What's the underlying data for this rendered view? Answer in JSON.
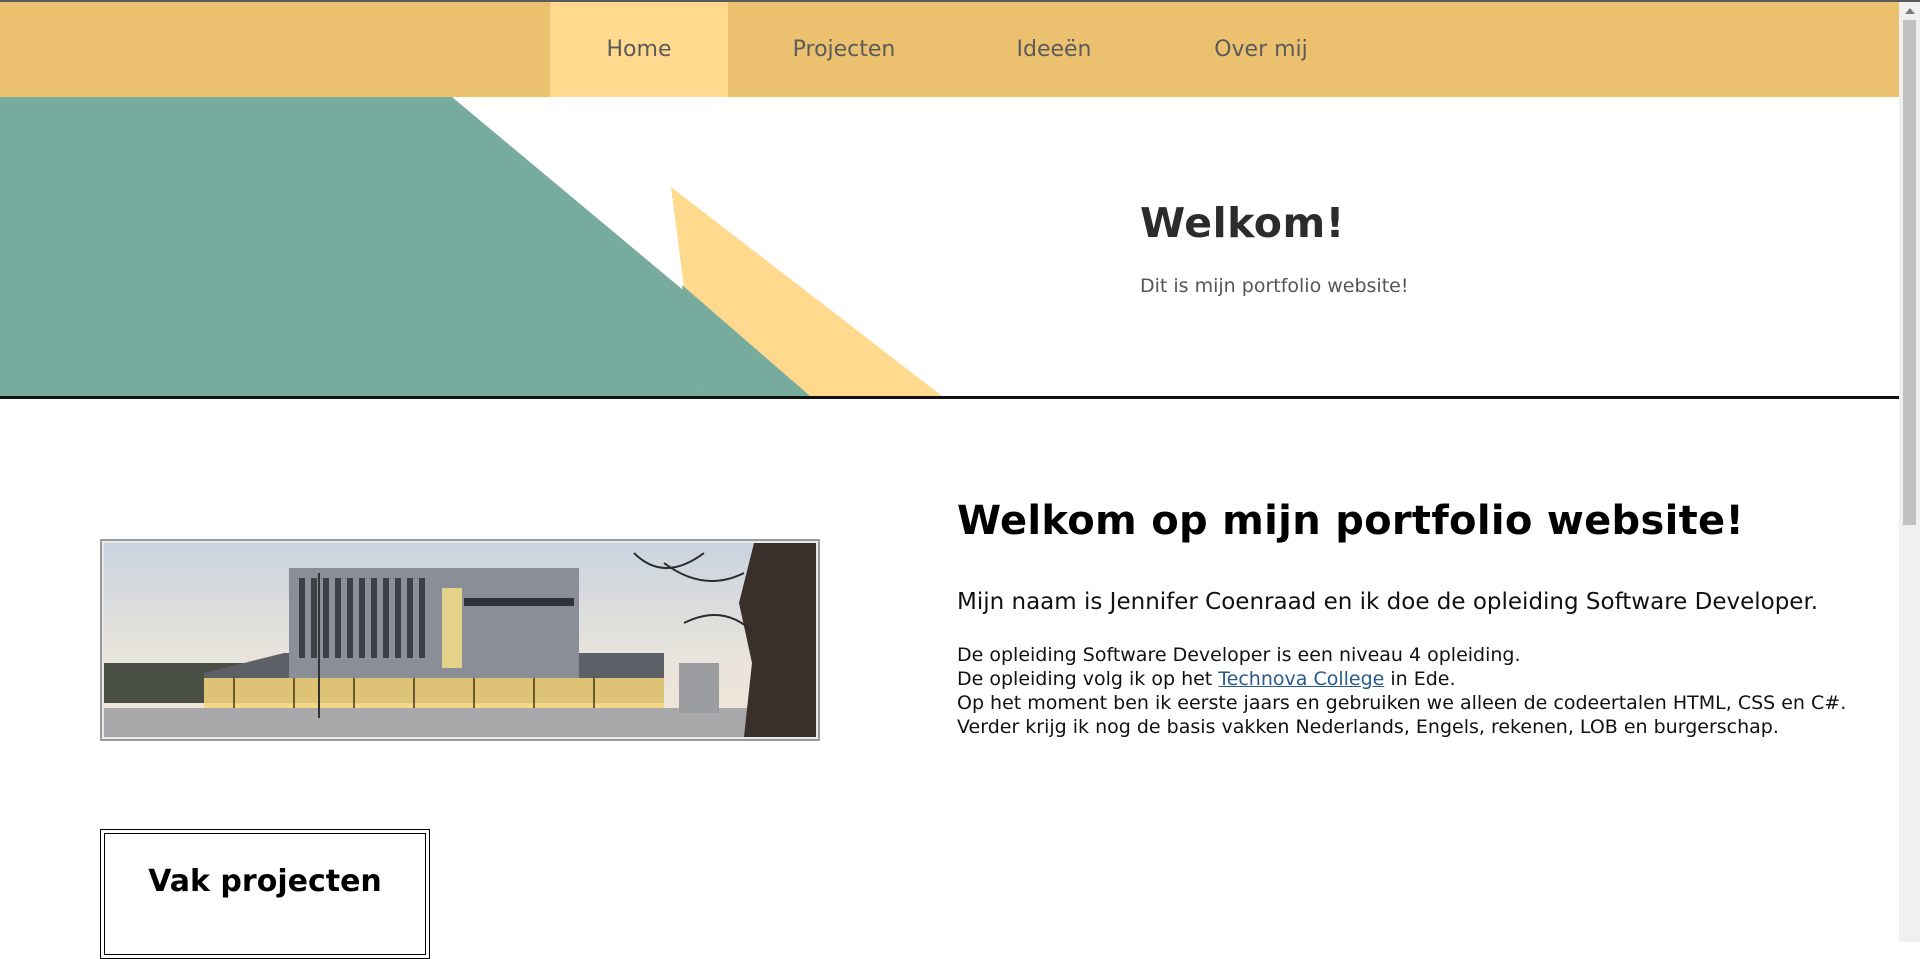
{
  "nav": {
    "items": [
      {
        "label": "Home",
        "active": true
      },
      {
        "label": "Projecten",
        "active": false
      },
      {
        "label": "Ideeën",
        "active": false
      },
      {
        "label": "Over mij",
        "active": false
      }
    ]
  },
  "hero": {
    "title": "Welkom!",
    "subtitle": "Dit is mijn portfolio website!"
  },
  "main": {
    "heading": "Welkom op mijn portfolio website!",
    "intro": "Mijn naam is Jennifer Coenraad en ik doe de opleiding Software Developer.",
    "line1": "De opleiding Software Developer is een niveau 4 opleiding.",
    "line2_before": "De opleiding volg ik op het ",
    "line2_link": "Technova College",
    "line2_after": " in Ede.",
    "line3": "Op het moment ben ik eerste jaars en gebruiken we alleen de codeertalen HTML, CSS en C#.",
    "line4": "Verder krijg ik nog de basis vakken Nederlands, Engels, rekenen, LOB en burgerschap."
  },
  "projects": {
    "title": "Vak projecten"
  },
  "colors": {
    "nav_bg": "#ebc16f",
    "nav_active": "#ffd98e",
    "teal": "#76ab9e",
    "yellow": "#ffd98e",
    "link": "#2a5b8a"
  }
}
